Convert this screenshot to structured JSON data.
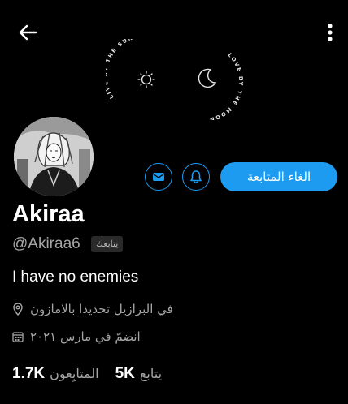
{
  "header": {
    "back_icon": "arrow-left-icon",
    "more_icon": "more-vertical-icon"
  },
  "banner": {
    "left_text": "LIVE BY THE SUN",
    "right_text": "LOVE BY THE MOON",
    "left_icon": "sun-icon",
    "right_icon": "moon-icon"
  },
  "actions": {
    "message_icon": "mail-icon",
    "notify_icon": "bell-icon",
    "unfollow_label": "الغاء المتابعة",
    "accent_color": "#1d9bf0"
  },
  "profile": {
    "display_name": "Akiraa",
    "handle": "@Akiraa6",
    "follows_you": "يتابعك",
    "bio": "I have no enemies",
    "location": "في البرازيل تحديدا بالامازون",
    "joined": "انضمّ في مارس ٢٠٢١",
    "location_icon": "location-pin-icon",
    "joined_icon": "calendar-icon"
  },
  "stats": {
    "following_count": "5K",
    "following_label": "يتابع",
    "followers_count": "1.7K",
    "followers_label": "المتابِعون"
  }
}
